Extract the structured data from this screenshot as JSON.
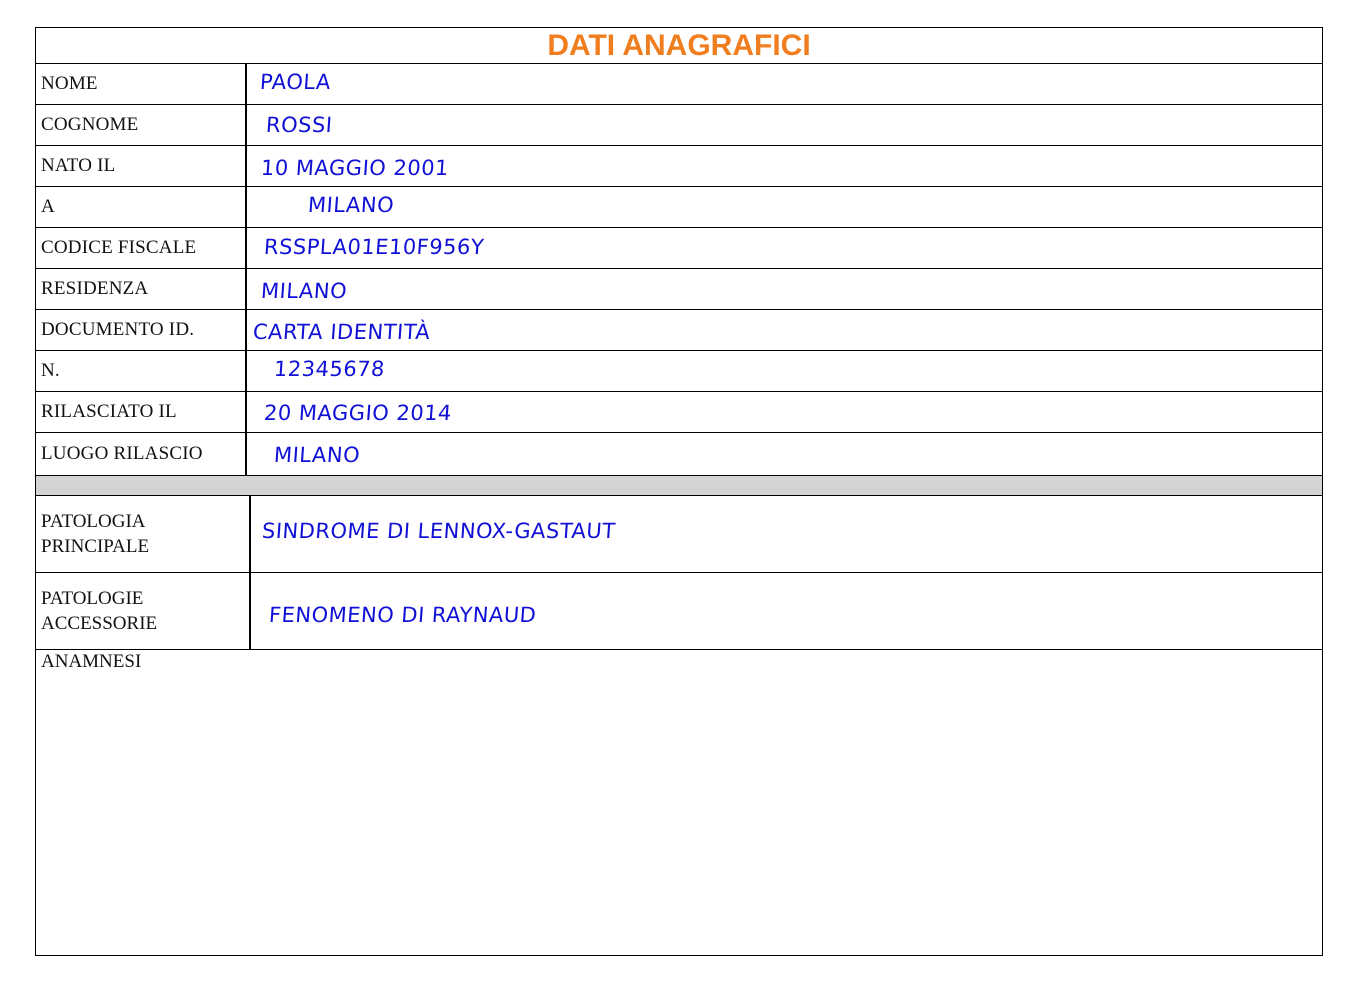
{
  "title": "DATI ANAGRAFICI",
  "fields": [
    {
      "label": "NOME",
      "value": "PAOLA"
    },
    {
      "label": "COGNOME",
      "value": "ROSSI"
    },
    {
      "label": "NATO IL",
      "value": "10 MAGGIO 2001"
    },
    {
      "label": "A",
      "value": "MILANO"
    },
    {
      "label": "CODICE FISCALE",
      "value": "RSSPLA01E10F956Y"
    },
    {
      "label": "RESIDENZA",
      "value": "MILANO"
    },
    {
      "label": "DOCUMENTO ID.",
      "value": "CARTA IDENTITÀ"
    },
    {
      "label": "N.",
      "value": "12345678"
    },
    {
      "label": "RILASCIATO IL",
      "value": "20 MAGGIO 2014"
    },
    {
      "label": "LUOGO RILASCIO",
      "value": "MILANO"
    }
  ],
  "pathologies": [
    {
      "label_line1": "PATOLOGIA",
      "label_line2": "PRINCIPALE",
      "value": "SINDROME DI LENNOX-GASTAUT"
    },
    {
      "label_line1": "PATOLOGIE",
      "label_line2": "ACCESSORIE",
      "value": "FENOMENO DI RAYNAUD"
    }
  ],
  "anamnesi_label": "ANAMNESI",
  "colors": {
    "title": "#f07e1f",
    "handwriting": "#1010d6",
    "separator": "#d3d3d3"
  }
}
